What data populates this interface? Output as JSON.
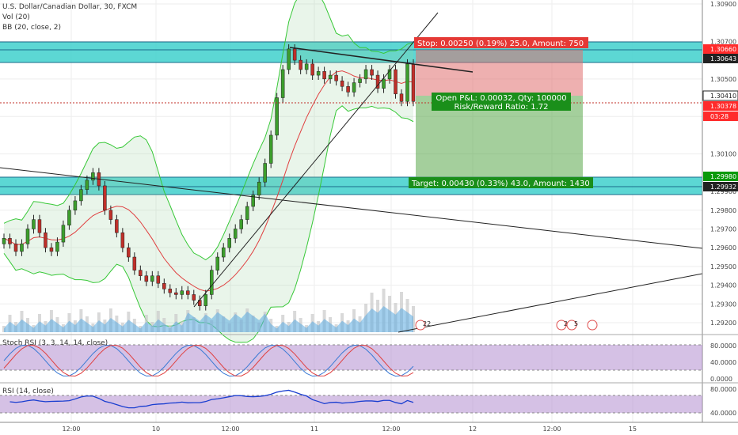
{
  "header": {
    "title": "U.S. Dollar/Canadian Dollar, 30, FXCM",
    "vol": "Vol (20)",
    "bb": "BB (20, close, 2)",
    "stoch": "Stoch RSI (3, 3, 14, 14, close)",
    "rsi": "RSI (14, close)"
  },
  "price_axis": {
    "ticks": [
      "1.30900",
      "1.30700",
      "1.30500",
      "1.30300",
      "1.30100",
      "1.29900",
      "1.29800",
      "1.29700",
      "1.29600",
      "1.29500",
      "1.29400",
      "1.29300",
      "1.29200"
    ],
    "badges": [
      {
        "value": "1.30660",
        "color": "#ff2b2b"
      },
      {
        "value": "1.30643",
        "color": "#222222"
      },
      {
        "value": "1.30410",
        "color": "#ffffff",
        "text_color": "#222222"
      },
      {
        "value": "1.30378",
        "color": "#ff2b2b"
      },
      {
        "value": "03:28",
        "color": "#ff2b2b"
      },
      {
        "value": "1.29980",
        "color": "#0a9a0a"
      },
      {
        "value": "1.29932",
        "color": "#222222"
      }
    ]
  },
  "stoch_axis": [
    "80.0000",
    "40.0000",
    "0.0000"
  ],
  "rsi_axis": [
    "80.0000",
    "40.0000"
  ],
  "time_axis": [
    "12:00",
    "10",
    "12:00",
    "11",
    "12:00",
    "12",
    "12:00",
    "15"
  ],
  "trade": {
    "stop": "Stop: 0.00250 (0.19%) 25.0, Amount: 750",
    "open_line1": "Open P&L: 0.00032, Qty: 100000",
    "open_line2": "Risk/Reward Ratio: 1.72",
    "target": "Target: 0.00430 (0.33%) 43.0, Amount: 1430"
  },
  "events": [
    "22",
    "26",
    "5"
  ],
  "colors": {
    "zone": "#3fd0cc",
    "stop": "#e07070",
    "target": "#5aa84a",
    "up": "#3c9e2c",
    "down": "#c0302a",
    "bb": "#37c837",
    "ma": "#e04040",
    "vol": "#5aa9e0",
    "stoch_bg": "#b38ecf",
    "rsi_line": "#1a3ed0"
  },
  "chart_data": {
    "type": "candlestick",
    "symbol": "USD/CAD",
    "timeframe": "30",
    "ylim": [
      1.2915,
      1.3095
    ],
    "closes": [
      1.2965,
      1.2962,
      1.2958,
      1.2962,
      1.297,
      1.2975,
      1.2968,
      1.296,
      1.2958,
      1.2963,
      1.2972,
      1.298,
      1.2985,
      1.2991,
      1.2996,
      1.3,
      1.2993,
      1.298,
      1.2975,
      1.2968,
      1.296,
      1.2955,
      1.2948,
      1.2945,
      1.2942,
      1.2945,
      1.2941,
      1.2938,
      1.2936,
      1.2935,
      1.2937,
      1.2935,
      1.2932,
      1.2929,
      1.2935,
      1.2948,
      1.2955,
      1.296,
      1.2965,
      1.297,
      1.2975,
      1.2982,
      1.2988,
      1.2995,
      1.3005,
      1.302,
      1.304,
      1.3055,
      1.3066,
      1.306,
      1.3055,
      1.3058,
      1.3052,
      1.3054,
      1.305,
      1.3052,
      1.3049,
      1.3046,
      1.3043,
      1.3048,
      1.305,
      1.3055,
      1.3052,
      1.3045,
      1.305,
      1.3055,
      1.3042,
      1.3038,
      1.3058,
      1.3038
    ]
  }
}
